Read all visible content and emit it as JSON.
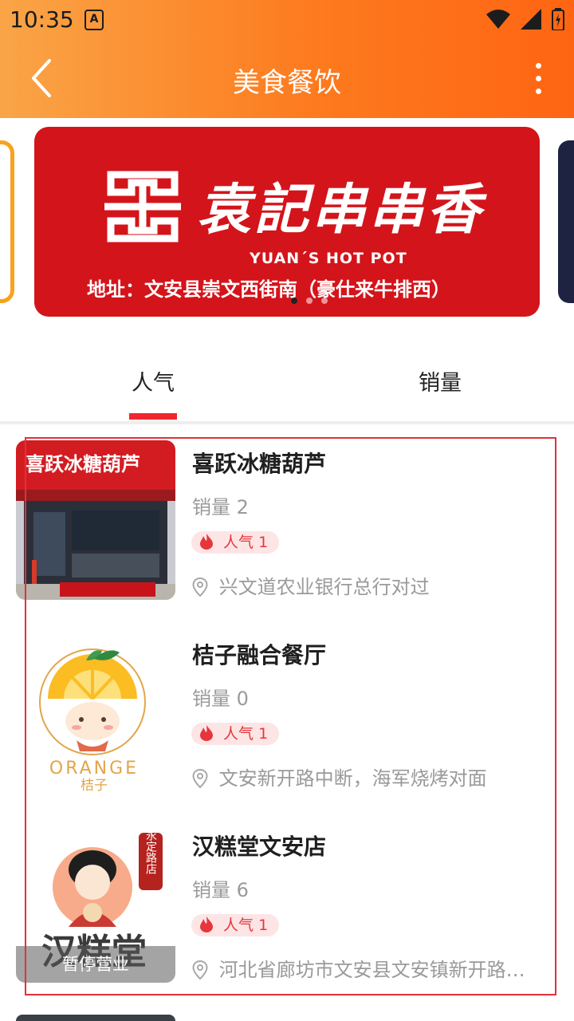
{
  "status_bar": {
    "time": "10:35",
    "notif_icon_letter": "A"
  },
  "header": {
    "title": "美食餐饮"
  },
  "banner": {
    "brand_cn": "袁記串串香",
    "brand_en": "YUAN´S HOT POT",
    "address": "地址：文安县崇文西街南（豪仕来牛排西）",
    "dots": 3,
    "active_dot": 0
  },
  "tabs": [
    {
      "label": "人气",
      "active": true
    },
    {
      "label": "销量",
      "active": false
    }
  ],
  "stores": [
    {
      "name": "喜跃冰糖葫芦",
      "sales": "销量 2",
      "popularity": "人气 1",
      "address": "兴文道农业银行总行对过",
      "closed": false,
      "sign_text": "喜跃冰糖葫芦"
    },
    {
      "name": "桔子融合餐厅",
      "sales": "销量 0",
      "popularity": "人气 1",
      "address": "文安新开路中断，海军烧烤对面",
      "closed": false,
      "logo_text": "ORANGE",
      "logo_sub": "桔子"
    },
    {
      "name": "汉糕堂文安店",
      "sales": "销量 6",
      "popularity": "人气 1",
      "address": "河北省廊坊市文安县文安镇新开路…",
      "closed": true,
      "closed_label": "暂停营业",
      "logo_text": "汉糕堂",
      "stamp_text": "永定路店"
    }
  ],
  "colors": {
    "accent": "#f0262f",
    "appbar_start": "#f9a547",
    "appbar_end": "#fe6513",
    "banner_red": "#d4141b"
  }
}
